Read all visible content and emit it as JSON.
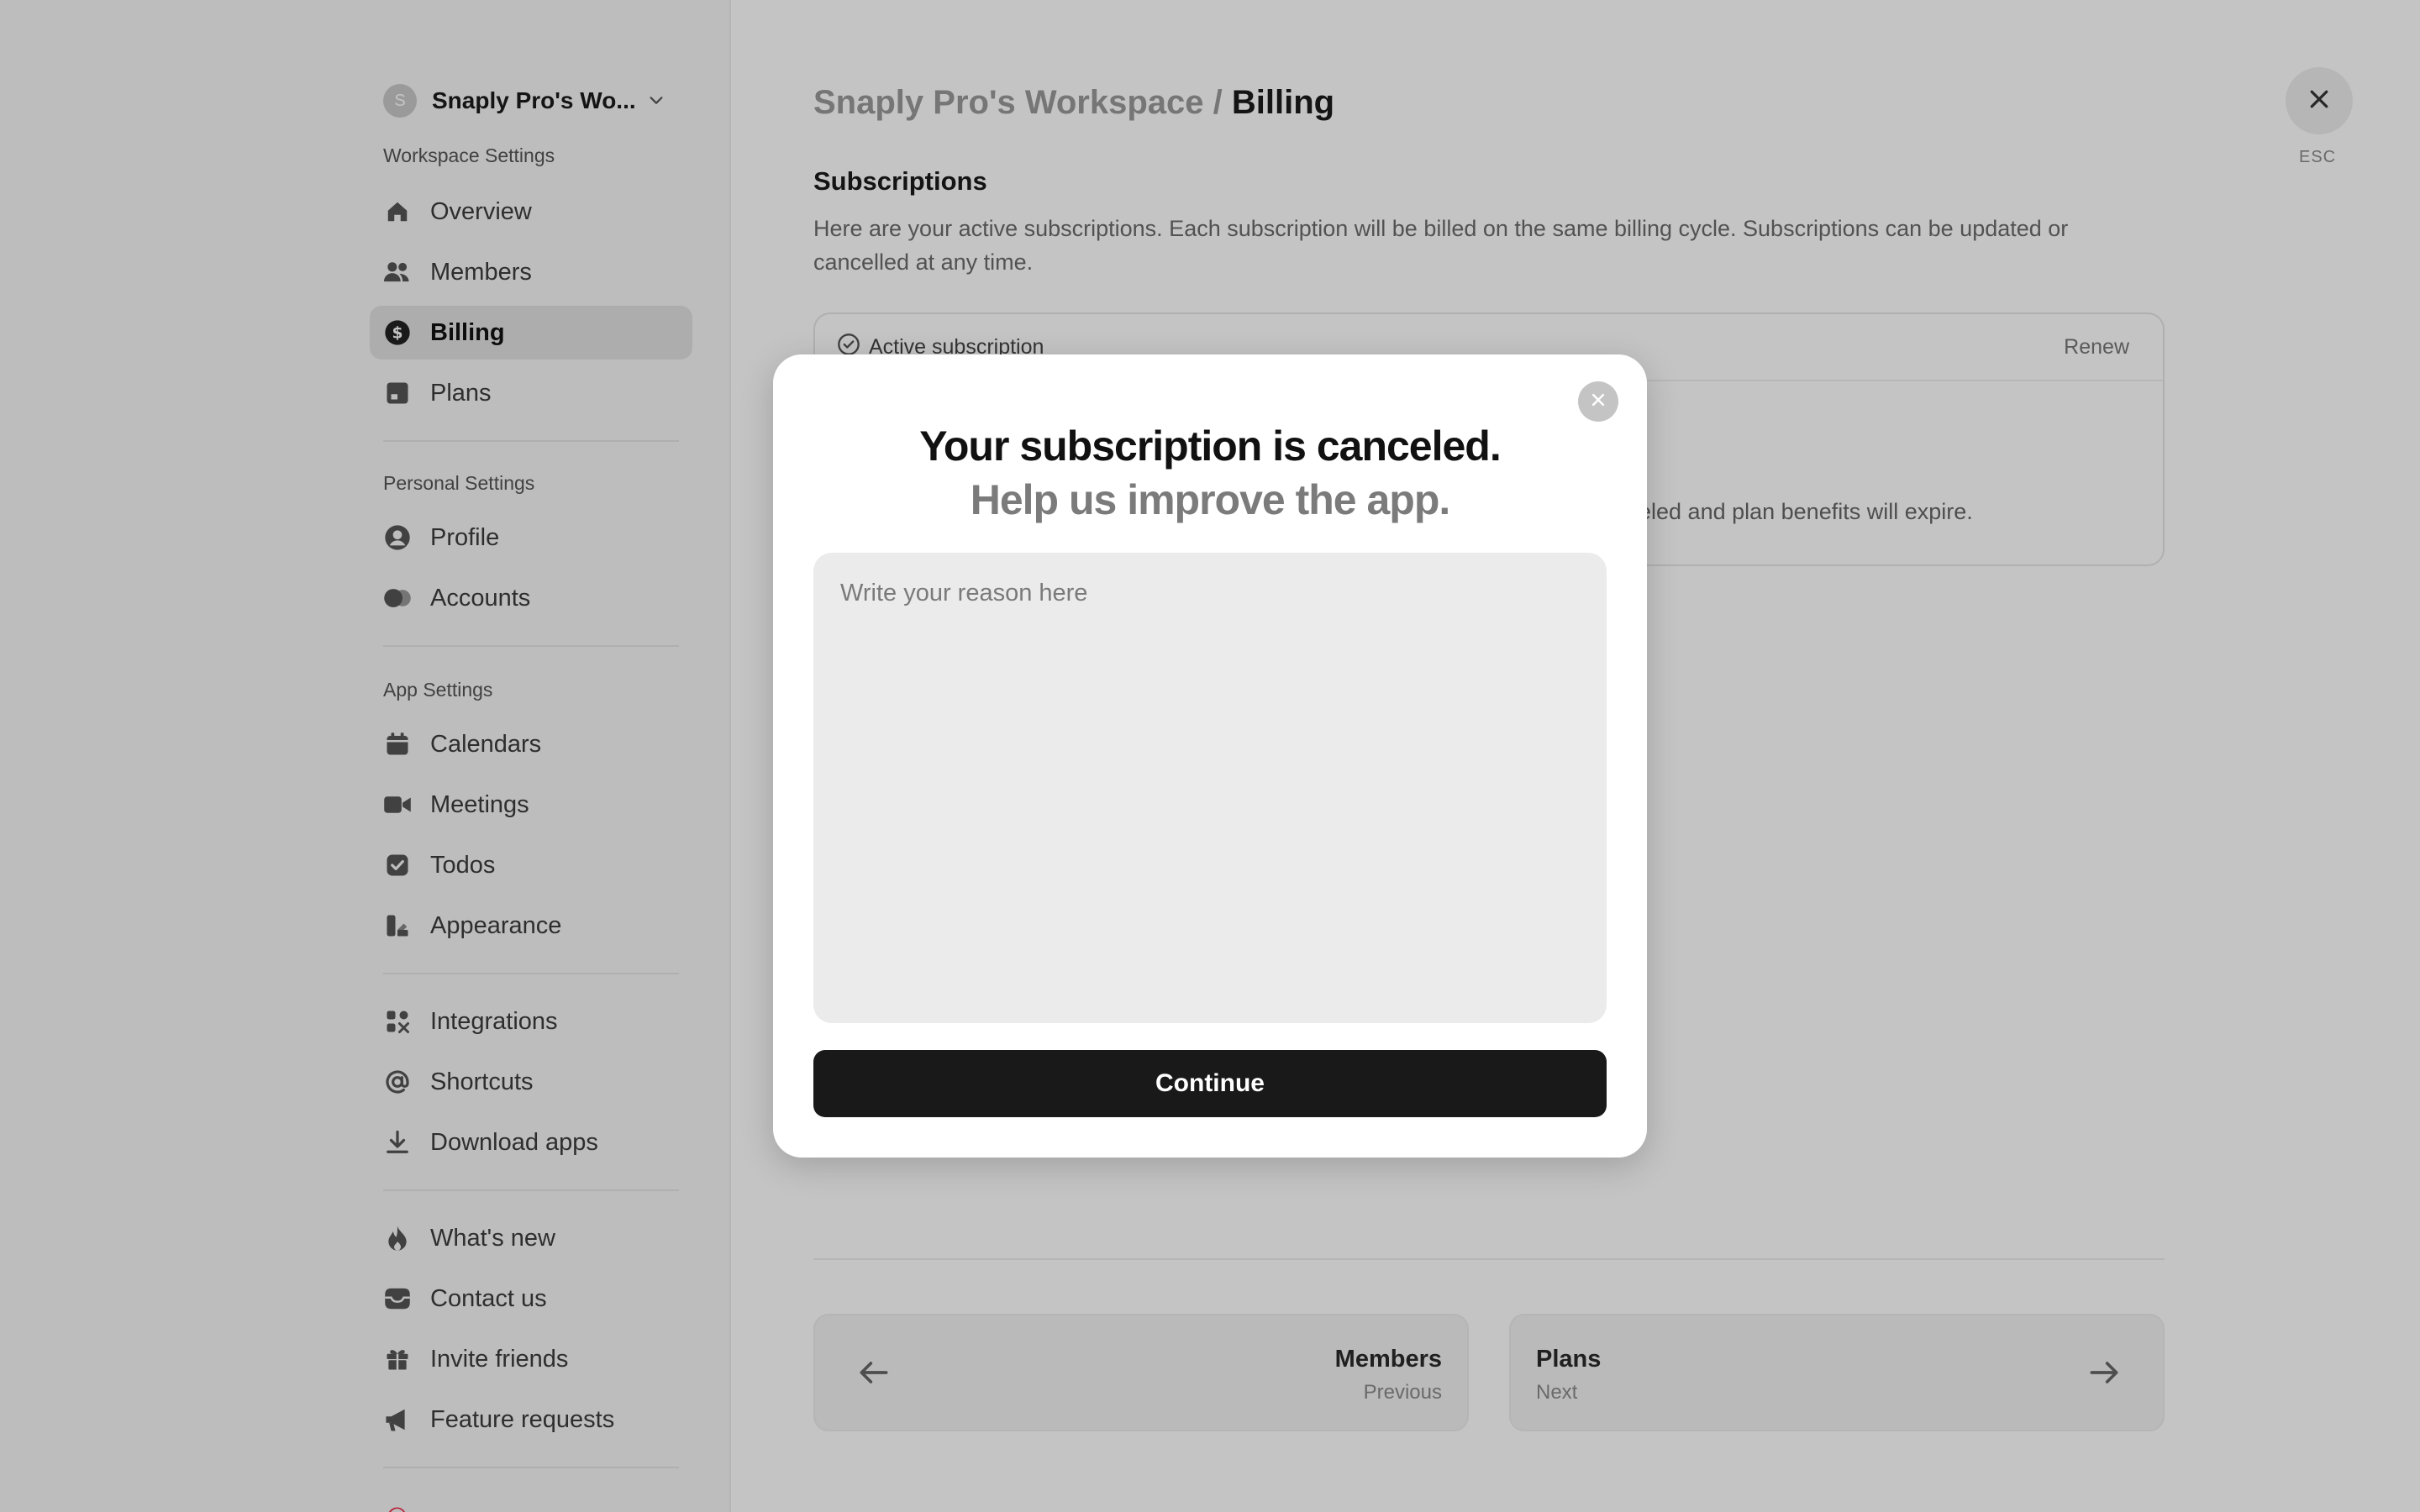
{
  "workspace": {
    "avatar_letter": "S",
    "name": "Snaply Pro's Wo..."
  },
  "sidebar": {
    "sections": [
      {
        "title": "Workspace Settings",
        "items": [
          {
            "label": "Overview",
            "icon": "home-icon"
          },
          {
            "label": "Members",
            "icon": "users-icon"
          },
          {
            "label": "Billing",
            "icon": "dollar-circle-icon",
            "active": true
          },
          {
            "label": "Plans",
            "icon": "plans-icon"
          }
        ]
      },
      {
        "title": "Personal Settings",
        "items": [
          {
            "label": "Profile",
            "icon": "user-circle-icon"
          },
          {
            "label": "Accounts",
            "icon": "toggle-icon"
          }
        ]
      },
      {
        "title": "App Settings",
        "items": [
          {
            "label": "Calendars",
            "icon": "calendar-icon"
          },
          {
            "label": "Meetings",
            "icon": "video-icon"
          },
          {
            "label": "Todos",
            "icon": "checkbox-icon"
          },
          {
            "label": "Appearance",
            "icon": "palette-icon"
          }
        ]
      },
      {
        "title": "",
        "items": [
          {
            "label": "Integrations",
            "icon": "apps-icon"
          },
          {
            "label": "Shortcuts",
            "icon": "at-icon"
          },
          {
            "label": "Download apps",
            "icon": "download-icon"
          }
        ]
      },
      {
        "title": "",
        "items": [
          {
            "label": "What's new",
            "icon": "flame-icon"
          },
          {
            "label": "Contact us",
            "icon": "inbox-icon"
          },
          {
            "label": "Invite friends",
            "icon": "gift-icon"
          },
          {
            "label": "Feature requests",
            "icon": "megaphone-icon"
          }
        ]
      }
    ]
  },
  "main": {
    "breadcrumb_workspace": "Snaply Pro's Workspace",
    "breadcrumb_sep": "/",
    "breadcrumb_current": "Billing",
    "section_title": "Subscriptions",
    "description": "Here are your active subscriptions. Each subscription will be billed on the same billing cycle. Subscriptions can be updated or cancelled at any time.",
    "subscription_status": "Active subscription",
    "renew_label": "Renew",
    "subscription_note": "eled and plan benefits will expire.",
    "esc_label": "ESC",
    "prev": {
      "title": "Members",
      "caption": "Previous"
    },
    "next": {
      "title": "Plans",
      "caption": "Next"
    }
  },
  "modal": {
    "title": "Your subscription is canceled.",
    "subtitle": "Help us improve the app.",
    "textarea_placeholder": "Write your reason here",
    "textarea_value": "",
    "continue_label": "Continue"
  },
  "colors": {
    "overlay": "rgba(0,0,0,0.23)",
    "primary_button": "#191919",
    "textarea_bg": "#ebebeb"
  }
}
